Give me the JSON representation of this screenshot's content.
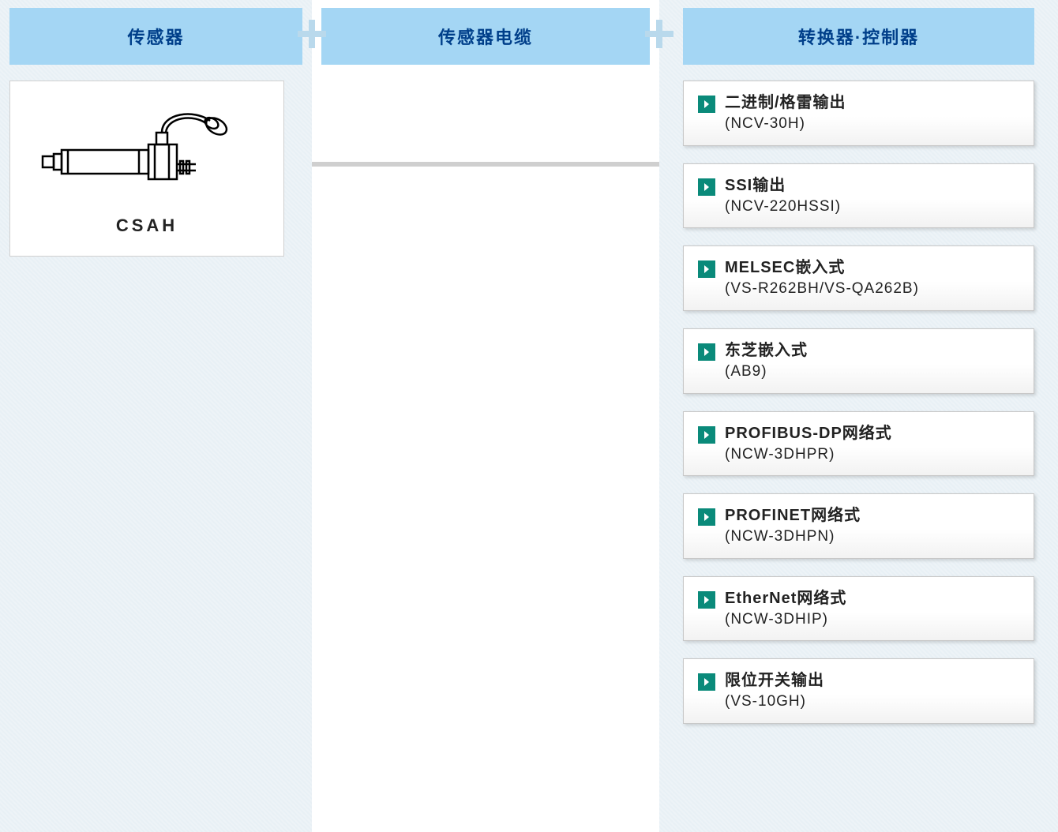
{
  "columns": {
    "sensor": {
      "header": "传感器",
      "card_label": "CSAH"
    },
    "cable": {
      "header": "传感器电缆"
    },
    "controller": {
      "header": "转换器·控制器",
      "options": [
        {
          "title": "二进制/格雷输出",
          "sub": "(NCV-30H)"
        },
        {
          "title": "SSI输出",
          "sub": "(NCV-220HSSI)"
        },
        {
          "title": "MELSEC嵌入式",
          "sub": "(VS-R262BH/VS-QA262B)"
        },
        {
          "title": "东芝嵌入式",
          "sub": "(AB9)"
        },
        {
          "title": "PROFIBUS-DP网络式",
          "sub": "(NCW-3DHPR)"
        },
        {
          "title": "PROFINET网络式",
          "sub": "(NCW-3DHPN)"
        },
        {
          "title": "EtherNet网络式",
          "sub": "(NCW-3DHIP)"
        },
        {
          "title": "限位开关输出",
          "sub": "(VS-10GH)"
        }
      ]
    }
  }
}
